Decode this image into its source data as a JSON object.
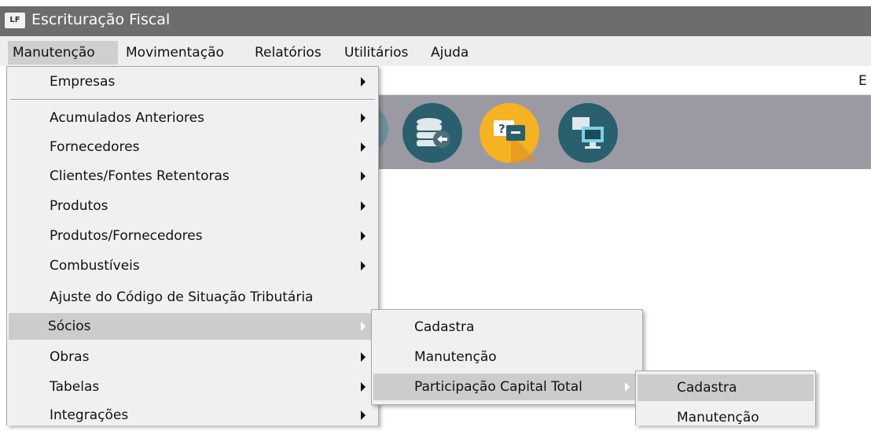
{
  "window": {
    "title": "Escrituração Fiscal",
    "app_icon_text": "LF"
  },
  "menubar": {
    "items": [
      "Manutenção",
      "Movimentação",
      "Relatórios",
      "Utilitários",
      "Ajuda"
    ]
  },
  "background": {
    "edge_text": "E"
  },
  "toolbar_icons": [
    "database-sync-icon",
    "help-chat-icon",
    "remote-screen-icon"
  ],
  "manutencao_menu": {
    "items": [
      {
        "label": "Empresas",
        "submenu": true
      },
      {
        "label": "Acumulados Anteriores",
        "submenu": true
      },
      {
        "label": "Fornecedores",
        "submenu": true
      },
      {
        "label": "Clientes/Fontes Retentoras",
        "submenu": true
      },
      {
        "label": "Produtos",
        "submenu": true
      },
      {
        "label": "Produtos/Fornecedores",
        "submenu": true
      },
      {
        "label": "Combustíveis",
        "submenu": true
      },
      {
        "label": "Ajuste do Código de Situação Tributária",
        "submenu": false
      },
      {
        "label": "Sócios",
        "submenu": true,
        "selected": true
      },
      {
        "label": "Obras",
        "submenu": true
      },
      {
        "label": "Tabelas",
        "submenu": true
      },
      {
        "label": "Integrações",
        "submenu": true
      }
    ]
  },
  "socios_menu": {
    "items": [
      {
        "label": "Cadastra",
        "submenu": false
      },
      {
        "label": "Manutenção",
        "submenu": false
      },
      {
        "label": "Participação Capital Total",
        "submenu": true,
        "selected": true
      }
    ]
  },
  "participacao_menu": {
    "items": [
      {
        "label": "Cadastra",
        "selected": true
      },
      {
        "label": "Manutenção"
      }
    ]
  },
  "colors": {
    "titlebar": "#6d6d6d",
    "toolbar": "#9b9aa3",
    "menu_bg": "#f0f0f0",
    "menu_selected": "#cccccc",
    "icon_teal": "#2a5f6e",
    "icon_orange": "#f5b223"
  }
}
